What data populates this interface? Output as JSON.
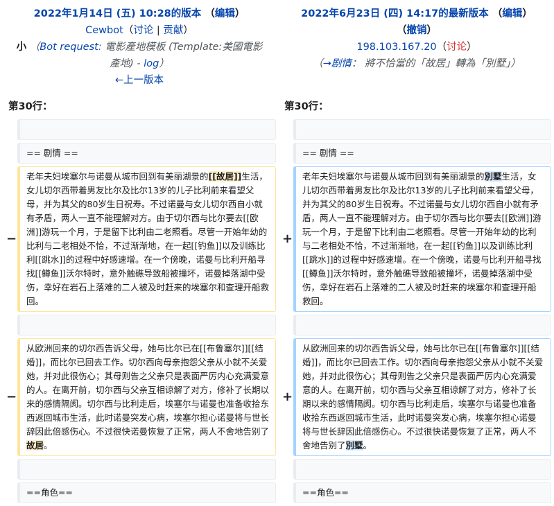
{
  "left_header": {
    "title": "2022年1月14日 (五) 10:28的版本",
    "edit_label": "编辑",
    "user": "Cewbot",
    "talk_label": "讨论",
    "contribs_label": "贡献",
    "minor_mark": "小",
    "summary_link": "Bot request",
    "summary_text": ": 電影產地模板 (Template:美國電影",
    "summary_text2": "產地) - ",
    "summary_log": "log",
    "prev_label": "←上一版本"
  },
  "right_header": {
    "title": "2022年6月23日 (四) 14:17的最新版本",
    "edit_label": "编辑",
    "undo_label": "撤销",
    "user": "198.103.167.20",
    "talk_label": "讨论",
    "summary_arrow": "→剧情",
    "summary_text": "： 將不恰當的「故居」轉為「別墅」"
  },
  "line_label": "第30行：",
  "diff": {
    "heading_plot": "== 剧情 ==",
    "heading_roles": "==角色==",
    "p1_left_a": "老年夫妇埃塞尔与诺曼从城市回到有美丽湖景的",
    "p1_left_hl": "[[故居]]",
    "p1_left_b": "生活，女儿切尔西带着男友比尔及比尔13岁的儿子比利前来看望父母，并为其父的80岁生日祝寿。不过诺曼与女儿切尔西自小就有矛盾，两人一直不能理解对方。由于切尔西与比尔要去[[欧洲]]游玩一个月，于是留下比利由二老照看。尽管一开始年幼的比利与二老相处不恰，不过渐渐地，在一起[[钓鱼]]以及训练比利[[跳水]]的过程中好感速增。在一个傍晚，诺曼与比利开船寻找[[鳟鱼]]沃尔特时，意外触礁导致船被撞坏，诺曼掉落湖中受伤，幸好在岩石上落难的二人被及时赶来的埃塞尔和查理开船救回。",
    "p1_right_a": "老年夫妇埃塞尔与诺曼从城市回到有美丽湖景的",
    "p1_right_hl": "別墅",
    "p1_right_b": "生活，女儿切尔西带着男友比尔及比尔13岁的儿子比利前来看望父母，并为其父的80岁生日祝寿。不过诺曼与女儿切尔西自小就有矛盾，两人一直不能理解对方。由于切尔西与比尔要去[[欧洲]]游玩一个月，于是留下比利由二老照看。尽管一开始年幼的比利与二老相处不恰，不过渐渐地，在一起[[钓鱼]]以及训练比利[[跳水]]的过程中好感速增。在一个傍晚，诺曼与比利开船寻找[[鳟鱼]]沃尔特时，意外触礁导致船被撞坏，诺曼掉落湖中受伤，幸好在岩石上落难的二人被及时赶来的埃塞尔和查理开船救回。",
    "p2_a": "从欧洲回来的切尔西告诉父母，她与比尔已在[[布鲁塞尔]][[结婚]]，而比尔已回去工作。切尔西向母亲抱怨父亲从小就不关爱她，并对此很伤心；其母则告之父亲只是表面严厉内心充满爱意的人。在离开前，切尔西与父亲互相谅解了对方，修补了长期以来的感情隔阂。切尔西与比利走后，埃塞尔与诺曼也准备收拾东西返回城市生活，此时诺曼突发心病，埃塞尔担心诺曼将与世长辞因此倍感伤心。不过很快诺曼恢复了正常，两人不舍地告别了",
    "p2_left_hl": "故居",
    "p2_right_hl": "別墅",
    "p2_end": "。",
    "minus": "−",
    "plus": "+"
  }
}
